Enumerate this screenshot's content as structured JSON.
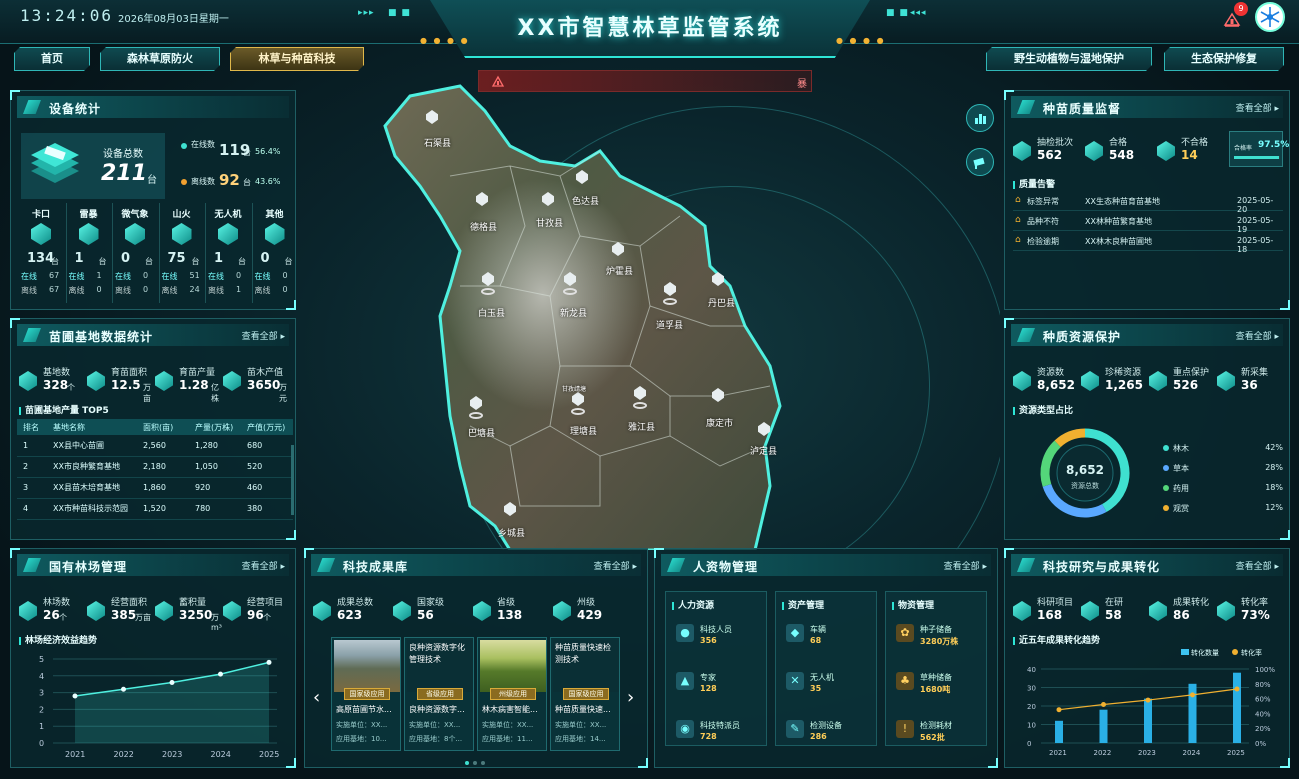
{
  "header": {
    "clock": "13:24:06",
    "date": "2026年08月03日星期一",
    "title": "XX市智慧林草监管系统",
    "alert_badge": "9"
  },
  "nav": {
    "left": [
      "首页",
      "森林草原防火",
      "林草与种苗科技"
    ],
    "right": [
      "野生动植物与湿地保护",
      "生态保护修复"
    ],
    "active": "林草与种苗科技"
  },
  "alarm": {
    "text": "",
    "right_text": "暴"
  },
  "device": {
    "title": "设备统计",
    "total_label": "设备总数",
    "total": "211",
    "total_unit": "台",
    "online_label": "在线数",
    "online": "119",
    "online_unit": "台",
    "online_pct": "56.4%",
    "offline_label": "离线数",
    "offline": "92",
    "offline_unit": "台",
    "offline_pct": "43.6%",
    "types": [
      {
        "name": "卡口",
        "count": "134",
        "online": "67",
        "offline": "67"
      },
      {
        "name": "雷暴",
        "count": "1",
        "online": "1",
        "offline": "0"
      },
      {
        "name": "微气象",
        "count": "0",
        "online": "0",
        "offline": "0"
      },
      {
        "name": "山火",
        "count": "75",
        "online": "51",
        "offline": "24"
      },
      {
        "name": "无人机",
        "count": "1",
        "online": "0",
        "offline": "1"
      },
      {
        "name": "其他",
        "count": "0",
        "online": "0",
        "offline": "0"
      }
    ],
    "unit": "台",
    "online_txt": "在线",
    "offline_txt": "离线"
  },
  "nursery": {
    "title": "苗圃基地数据统计",
    "more": "查看全部",
    "stats": [
      {
        "label": "基地数",
        "value": "328",
        "unit": "个"
      },
      {
        "label": "育苗面积",
        "value": "12.5",
        "unit": "万亩"
      },
      {
        "label": "育苗产量",
        "value": "1.28",
        "unit": "亿株"
      },
      {
        "label": "苗木产值",
        "value": "3650",
        "unit": "万元"
      }
    ],
    "top_title": "苗圃基地产量 TOP5",
    "columns": [
      "排名",
      "基地名称",
      "面积(亩)",
      "产量(万株)",
      "产值(万元)"
    ],
    "rows": [
      [
        "1",
        "XX县中心苗圃",
        "2,560",
        "1,280",
        "680"
      ],
      [
        "2",
        "XX市良种繁育基地",
        "2,180",
        "1,050",
        "520"
      ],
      [
        "3",
        "XX县苗木培育基地",
        "1,860",
        "920",
        "460"
      ],
      [
        "4",
        "XX市种苗科技示范园",
        "1,520",
        "780",
        "380"
      ]
    ]
  },
  "forest": {
    "title": "国有林场管理",
    "more": "查看全部",
    "stats": [
      {
        "label": "林场数",
        "value": "26",
        "unit": "个"
      },
      {
        "label": "经营面积",
        "value": "385",
        "unit": "万亩"
      },
      {
        "label": "蓄积量",
        "value": "3250",
        "unit": "万m³"
      },
      {
        "label": "经营项目",
        "value": "96",
        "unit": "个"
      }
    ],
    "chart_title": "林场经济效益趋势"
  },
  "forest_chart": {
    "type": "line",
    "x": [
      "2021",
      "2022",
      "2023",
      "2024",
      "2025"
    ],
    "values": [
      2.8,
      3.2,
      3.6,
      4.1,
      4.8
    ],
    "ylim": [
      0,
      5
    ],
    "yticks": [
      "0",
      "1",
      "2",
      "3",
      "4",
      "5"
    ]
  },
  "seedling": {
    "title": "种苗质量监督",
    "more": "查看全部",
    "stats": [
      {
        "label": "抽检批次",
        "value": "562"
      },
      {
        "label": "合格",
        "value": "548"
      },
      {
        "label": "不合格",
        "value": "14"
      }
    ],
    "rate_label": "合格率",
    "rate": "97.5%",
    "rate_fraction": 0.975,
    "alert_title": "质量告警",
    "alerts": [
      {
        "type": "标签异常",
        "site": "XX生态种苗育苗基地",
        "date": "2025-05-20"
      },
      {
        "type": "品种不符",
        "site": "XX林种苗繁育基地",
        "date": "2025-05-19"
      },
      {
        "type": "检验逾期",
        "site": "XX林木良种苗圃地",
        "date": "2025-05-18"
      }
    ]
  },
  "germplasm": {
    "title": "种质资源保护",
    "more": "查看全部",
    "stats": [
      {
        "label": "资源数",
        "value": "8,652"
      },
      {
        "label": "珍稀资源",
        "value": "1,265"
      },
      {
        "label": "重点保护",
        "value": "526"
      },
      {
        "label": "新采集",
        "value": "36"
      }
    ],
    "pie_title": "资源类型占比",
    "center_value": "8,652",
    "center_label": "资源总数"
  },
  "germplasm_chart": {
    "type": "pie",
    "labels": [
      "林木",
      "草本",
      "药用",
      "观赏"
    ],
    "values": [
      42,
      28,
      18,
      12
    ],
    "display": [
      "42%",
      "28%",
      "18%",
      "12%"
    ],
    "colors": [
      "#3fe0d0",
      "#5aa8ff",
      "#54d67a",
      "#f0b030"
    ]
  },
  "tech_results": {
    "title": "科技成果库",
    "more": "查看全部",
    "stats": [
      {
        "label": "成果总数",
        "value": "623"
      },
      {
        "label": "国家级",
        "value": "56"
      },
      {
        "label": "省级",
        "value": "138"
      },
      {
        "label": "州级",
        "value": "429"
      }
    ],
    "cards": [
      {
        "name": "高原苗圃节水...",
        "tag": "国家级应用",
        "unit": "实施单位：XX...",
        "base": "应用基地：10...",
        "img": "mountain",
        "alt": ""
      },
      {
        "name": "良种资源数字...",
        "tag": "省级应用",
        "unit": "实施单位：XX...",
        "base": "应用基地：8个...",
        "img": "broken",
        "alt": "良种资源数字化管理技术"
      },
      {
        "name": "林木病害智能...",
        "tag": "州级应用",
        "unit": "实施单位：XX...",
        "base": "应用基地：11...",
        "img": "field",
        "alt": ""
      },
      {
        "name": "种苗质量快速...",
        "tag": "国家级应用",
        "unit": "实施单位：XX...",
        "base": "应用基地：14...",
        "img": "broken",
        "alt": "种苗质量快速检测技术"
      }
    ],
    "prev": "‹",
    "next": "›"
  },
  "hr": {
    "title": "人资物管理",
    "more": "查看全部",
    "cols": [
      {
        "title": "人力资源",
        "items": [
          {
            "name": "科技人员",
            "value": "356",
            "icon": "person-icon"
          },
          {
            "name": "专家",
            "value": "128",
            "icon": "graduation-cap-icon"
          },
          {
            "name": "科技特派员",
            "value": "728",
            "icon": "team-icon"
          }
        ]
      },
      {
        "title": "资产管理",
        "items": [
          {
            "name": "车辆",
            "value": "68",
            "icon": "location-pin-icon"
          },
          {
            "name": "无人机",
            "value": "35",
            "icon": "drone-icon"
          },
          {
            "name": "检测设备",
            "value": "286",
            "icon": "tools-icon"
          }
        ]
      },
      {
        "title": "物资管理",
        "items": [
          {
            "name": "种子储备",
            "value": "3280万株",
            "icon": "seed-icon"
          },
          {
            "name": "草种储备",
            "value": "1680吨",
            "icon": "grass-icon"
          },
          {
            "name": "检测耗材",
            "value": "562批",
            "icon": "warning-icon"
          }
        ]
      }
    ]
  },
  "research": {
    "title": "科技研究与成果转化",
    "more": "查看全部",
    "stats": [
      {
        "label": "科研项目",
        "value": "168"
      },
      {
        "label": "在研",
        "value": "58"
      },
      {
        "label": "成果转化",
        "value": "86"
      },
      {
        "label": "转化率",
        "value": "73%"
      }
    ],
    "chart_title": "近五年成果转化趋势"
  },
  "research_chart": {
    "type": "bar",
    "x": [
      "2021",
      "2022",
      "2023",
      "2024",
      "2025"
    ],
    "series": [
      {
        "name": "转化数量",
        "values": [
          12,
          18,
          24,
          32,
          38
        ]
      },
      {
        "name": "转化率",
        "values": [
          45,
          52,
          58,
          65,
          73
        ]
      }
    ],
    "ylim": [
      0,
      40
    ],
    "y2lim": [
      0,
      100
    ],
    "yticks": [
      "0",
      "10",
      "20",
      "30",
      "40"
    ],
    "y2ticks": [
      "0%",
      "20%",
      "40%",
      "60%",
      "80%",
      "100%"
    ]
  },
  "map": {
    "counties": [
      {
        "name": "石渠县"
      },
      {
        "name": "色达县"
      },
      {
        "name": "德格县"
      },
      {
        "name": "甘孜县"
      },
      {
        "name": "炉霍县"
      },
      {
        "name": "白玉县"
      },
      {
        "name": "新龙县"
      },
      {
        "name": "道孚县"
      },
      {
        "name": "丹巴县"
      },
      {
        "name": "巴塘县"
      },
      {
        "name": "理塘县"
      },
      {
        "name": "雅江县"
      },
      {
        "name": "康定市"
      },
      {
        "name": "泸定县"
      },
      {
        "name": "乡城县"
      },
      {
        "name": "甘孜靖塘"
      }
    ]
  }
}
